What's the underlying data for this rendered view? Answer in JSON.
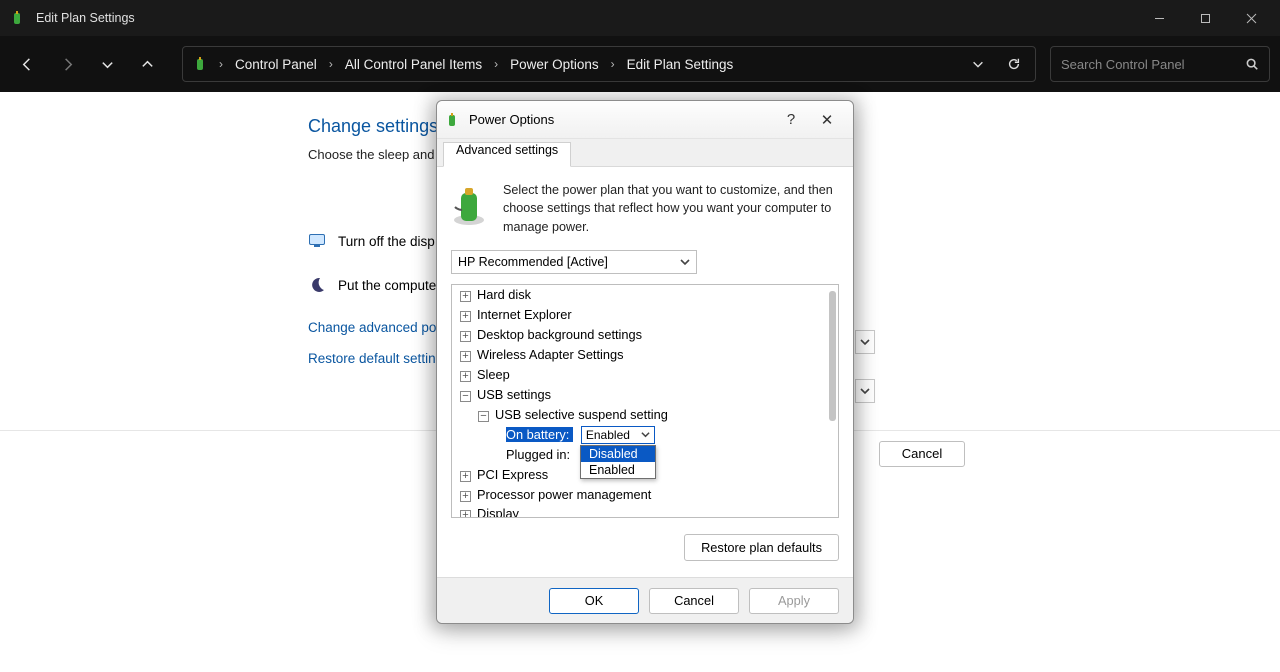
{
  "window": {
    "title": "Edit Plan Settings"
  },
  "breadcrumb": {
    "items": [
      "Control Panel",
      "All Control Panel Items",
      "Power Options",
      "Edit Plan Settings"
    ]
  },
  "search": {
    "placeholder": "Search Control Panel"
  },
  "page": {
    "heading": "Change settings",
    "subtitle": "Choose the sleep and",
    "row1": "Turn off the disp",
    "row2": "Put the compute",
    "link_advanced": "Change advanced po",
    "link_restore": "Restore default settin"
  },
  "page_footer": {
    "cancel": "Cancel"
  },
  "dialog": {
    "title": "Power Options",
    "tab": "Advanced settings",
    "explain": "Select the power plan that you want to customize, and then choose settings that reflect how you want your computer to manage power.",
    "plan": "HP Recommended [Active]",
    "tree": {
      "hard_disk": "Hard disk",
      "ie": "Internet Explorer",
      "desktop_bg": "Desktop background settings",
      "wifi": "Wireless Adapter Settings",
      "sleep": "Sleep",
      "usb_settings": "USB settings",
      "usb_selective": "USB selective suspend setting",
      "on_battery_label": "On battery:",
      "on_battery_value": "Enabled",
      "plugged_in_label": "Plugged in:",
      "pci": "PCI Express",
      "ppm": "Processor power management",
      "display": "Display"
    },
    "dropdown": {
      "opt1": "Disabled",
      "opt2": "Enabled"
    },
    "restore_defaults": "Restore plan defaults",
    "ok": "OK",
    "cancel": "Cancel",
    "apply": "Apply"
  }
}
